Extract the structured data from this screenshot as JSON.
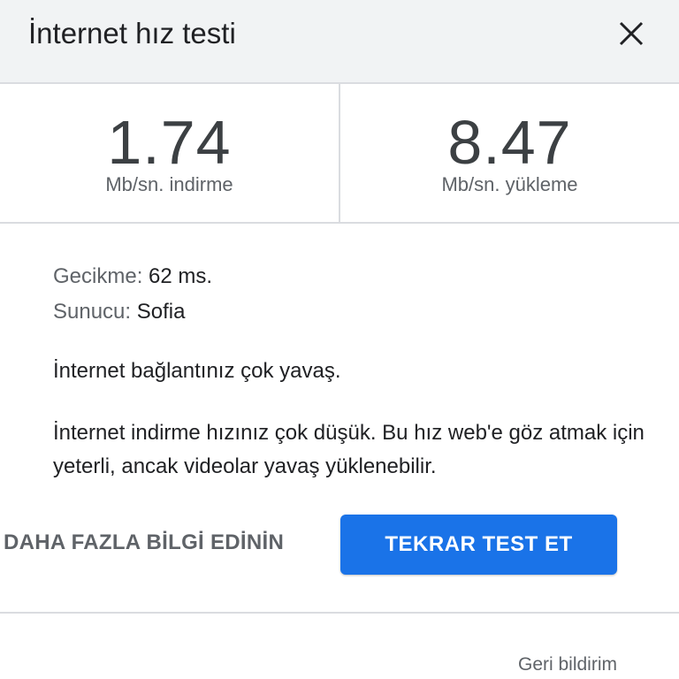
{
  "header": {
    "title": "İnternet hız testi",
    "close_icon": "close-icon"
  },
  "metrics": {
    "download": {
      "value": "1.74",
      "unit": "Mb/sn. indirme"
    },
    "upload": {
      "value": "8.47",
      "unit": "Mb/sn. yükleme"
    }
  },
  "details": {
    "latency_label": "Gecikme:",
    "latency_value": "62 ms.",
    "server_label": "Sunucu:",
    "server_value": "Sofia"
  },
  "summary": "İnternet bağlantınız çok yavaş.",
  "description": "İnternet indirme hızınız çok düşük. Bu hız web'e göz atmak için yeterli, ancak videolar yavaş yüklenebilir.",
  "actions": {
    "learn_more": "DAHA FAZLA BİLGİ EDİNİN",
    "retest": "TEKRAR TEST ET"
  },
  "footer": {
    "feedback": "Geri bildirim"
  },
  "colors": {
    "accent": "#1a73e8",
    "header_bg": "#f1f3f4",
    "divider": "#dadce0"
  }
}
